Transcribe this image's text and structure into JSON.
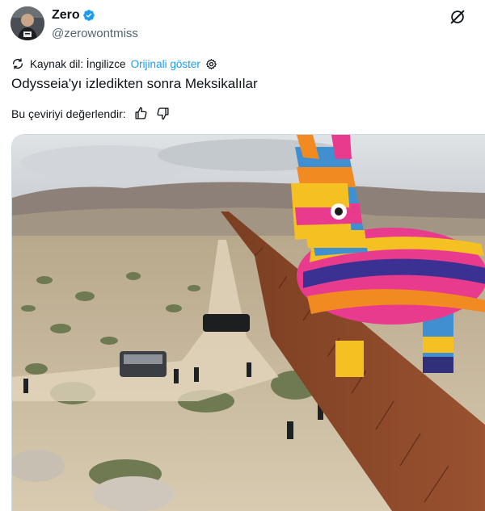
{
  "author": {
    "name": "Zero",
    "handle": "@zerowontmiss",
    "verified": true
  },
  "translation": {
    "source_label": "Kaynak dil: İngilizce",
    "show_original": "Orijinali göster"
  },
  "tweet": {
    "text": "Odysseia'yı izledikten sonra Meksikalılar"
  },
  "rating": {
    "prompt": "Bu çeviriyi değerlendir:"
  },
  "colors": {
    "link": "#1d9bf0",
    "verified": "#1d9bf0",
    "text": "#0f1419",
    "secondary": "#536471"
  },
  "icons": {
    "verified": "verified-badge-icon",
    "grok": "grok-icon",
    "translate": "translate-icon",
    "settings": "gear-icon",
    "thumbs_up": "thumbs-up-icon",
    "thumbs_down": "thumbs-down-icon"
  }
}
